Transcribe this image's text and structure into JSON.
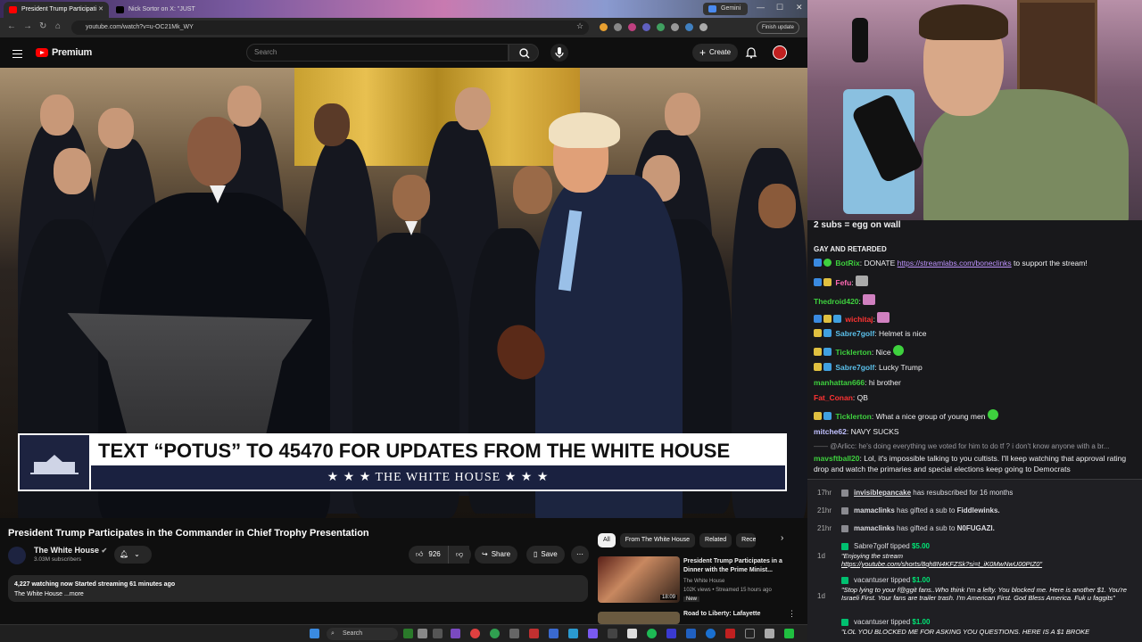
{
  "browser": {
    "tabs": [
      {
        "label": "President Trump Participati"
      },
      {
        "label": "Nick Sortor on X: \"JUST"
      },
      {
        "label": "Gemini"
      }
    ],
    "url": "youtube.com/watch?v=u-OC21Mk_WY",
    "finish_update": "Finish update"
  },
  "youtube": {
    "brand": "Premium",
    "search_placeholder": "Search",
    "create": "Create",
    "banner_text": "TEXT “POTUS” TO 45470 FOR UPDATES FROM THE WHITE HOUSE",
    "banner_sub": "★ ★ ★  THE WHITE HOUSE  ★ ★ ★",
    "video_title": "President Trump Participates in the Commander in Chief Trophy Presentation",
    "channel": "The White House",
    "subscribers": "3.03M subscribers",
    "likes": "926",
    "share": "Share",
    "save": "Save",
    "watching": "4,227 watching now",
    "started": "Started streaming 61 minutes ago",
    "desc_more": "The White House ...more",
    "chips": [
      "All",
      "From The White House",
      "Related",
      "Rece"
    ],
    "related": [
      {
        "title": "President Trump Participates in a Dinner with the Prime Minist...",
        "channel": "The White House",
        "meta": "102K views • Streamed 15 hours ago",
        "badge": "New",
        "duration": "18:09"
      },
      {
        "title": "Road to Liberty: Lafayette",
        "channel": "",
        "meta": "",
        "badge": "",
        "duration": ""
      }
    ]
  },
  "taskbar": {
    "search": "Search"
  },
  "chat": {
    "top_lines": [
      "2 subs = egg on wall",
      "GAY AND RETARDED"
    ],
    "messages": [
      {
        "user": "BotRix",
        "color": "#3ed13e",
        "text": "DONATE ",
        "link": "https://streamlabs.com/boneclinks",
        "after": " to support the stream!"
      },
      {
        "user": "Fefu",
        "color": "#ff69b4",
        "text": ""
      },
      {
        "user": "Thedroid420",
        "color": "#3ed13e",
        "text": ""
      },
      {
        "user": "wichitaj",
        "color": "#ff3333",
        "text": ""
      },
      {
        "user": "Sabre7golf",
        "color": "#5bc0eb",
        "text": "Helmet is nice"
      },
      {
        "user": "Ticklerton",
        "color": "#3ed13e",
        "text": "Nice"
      },
      {
        "user": "Sabre7golf",
        "color": "#5bc0eb",
        "text": "Lucky Trump"
      },
      {
        "user": "manhattan666",
        "color": "#3ed13e",
        "text": "hi brother"
      },
      {
        "user": "Fat_Conan",
        "color": "#ff3333",
        "text": "QB"
      },
      {
        "user": "Ticklerton",
        "color": "#3ed13e",
        "text": "What a nice group of young men"
      },
      {
        "user": "mitche62",
        "color": "#c0c0ff",
        "text": "NAVY SUCKS"
      }
    ],
    "reply_line": "@Arlicc: he's doing everything we voted for him to do tf ? i don't know anyone with a br...",
    "last_user": "mavsftball20",
    "last_text": "Lol, it's impossible talking to you cultists. I'll keep watching that approval rating",
    "last_text2": "drop and watch the primaries and special elections keep going to Democrats"
  },
  "events": [
    {
      "time": "17hr",
      "name": "invisiblepancake",
      "text": " has resubscribed for 16 months"
    },
    {
      "time": "21hr",
      "name": "mamaclinks",
      "text": " has gifted a sub to ",
      "target": "Fiddlewinks."
    },
    {
      "time": "21hr",
      "name": "mamaclinks",
      "text": " has gifted a sub to ",
      "target": "N0FUGAZI."
    },
    {
      "time": "1d",
      "name": "Sabre7golf",
      "text": " tipped ",
      "amount": "$5.00",
      "msg": "\"Enjoying the stream",
      "link": "https://youtube.com/shorts/8qh8N4KFZSk?si=t_iK0MwNwU00PIZ0\""
    },
    {
      "time": "1d",
      "name": "vacantuser",
      "text": " tipped ",
      "amount": "$1.00",
      "msg": "\"Stop lying to your f@ggit fans..Who think I'm a lefty. You blocked me. Here is another $1. You're Israeli First. Your fans are trailer trash. I'm American First. God Bless America. Fuk u faggits\""
    },
    {
      "time": "1d",
      "name": "vacantuser",
      "text": " tipped ",
      "amount": "$1.00",
      "msg": "\"LOL YOU BLOCKED ME FOR ASKING YOU QUESTIONS. HERE IS A $1 BROKE"
    }
  ],
  "colors": {
    "yt_red": "#ff0000",
    "chat_bg": "#18181b",
    "twitch_purple": "#9146ff",
    "tip_green": "#00e676"
  }
}
